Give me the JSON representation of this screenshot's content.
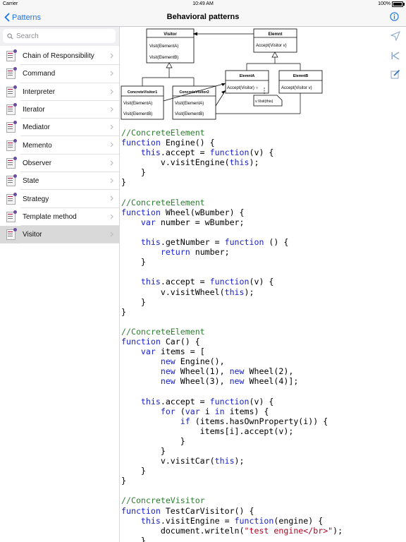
{
  "status_bar": {
    "carrier": "Carrier",
    "time": "10:49 AM",
    "battery": "100%"
  },
  "navbar": {
    "back_label": "Patterns",
    "title": "Behavioral patterns"
  },
  "search": {
    "placeholder": "Search"
  },
  "sidebar": {
    "items": [
      {
        "label": "Chain of Responsibility"
      },
      {
        "label": "Command"
      },
      {
        "label": "Interpreter"
      },
      {
        "label": "Iterator"
      },
      {
        "label": "Mediator"
      },
      {
        "label": "Memento"
      },
      {
        "label": "Observer"
      },
      {
        "label": "State"
      },
      {
        "label": "Strategy"
      },
      {
        "label": "Template method"
      },
      {
        "label": "Visitor",
        "selected": true
      }
    ]
  },
  "diagram": {
    "visitor": {
      "name": "Visitor",
      "ops": [
        "Visit(ElementA)",
        "Visit(ElementB)"
      ]
    },
    "element": {
      "name": "Elemnt",
      "ops": [
        "Accept(Visitor v)"
      ]
    },
    "concrete_visitor1": {
      "name": "ConcreteVisitor1",
      "ops": [
        "Visit(ElementA)",
        "Visit(ElementB)"
      ]
    },
    "concrete_visitor2": {
      "name": "ConcreteVisitor2",
      "ops": [
        "Visit(ElementA)",
        "Visit(ElementB)"
      ]
    },
    "element_a": {
      "name": "ElemntA",
      "ops": [
        "Accept(Visitor) ○"
      ]
    },
    "element_b": {
      "name": "ElemntB",
      "ops": [
        "Accept(Visitor v)"
      ]
    },
    "note": "v.Visit(this)"
  },
  "code_lines": [
    [
      {
        "t": "//ConcreteElement",
        "c": "c"
      }
    ],
    [
      {
        "t": "function",
        "c": "k"
      },
      {
        "t": " Engine() {"
      }
    ],
    [
      {
        "t": "    "
      },
      {
        "t": "this",
        "c": "k"
      },
      {
        "t": ".accept = "
      },
      {
        "t": "function",
        "c": "k"
      },
      {
        "t": "(v) {"
      }
    ],
    [
      {
        "t": "        v.visitEngine("
      },
      {
        "t": "this",
        "c": "k"
      },
      {
        "t": ");"
      }
    ],
    [
      {
        "t": "    }"
      }
    ],
    [
      {
        "t": "}"
      }
    ],
    [
      {
        "t": ""
      }
    ],
    [
      {
        "t": "//ConcreteElement",
        "c": "c"
      }
    ],
    [
      {
        "t": "function",
        "c": "k"
      },
      {
        "t": " Wheel(wBumber) {"
      }
    ],
    [
      {
        "t": "    "
      },
      {
        "t": "var",
        "c": "k"
      },
      {
        "t": " number = wBumber;"
      }
    ],
    [
      {
        "t": ""
      }
    ],
    [
      {
        "t": "    "
      },
      {
        "t": "this",
        "c": "k"
      },
      {
        "t": ".getNumber = "
      },
      {
        "t": "function",
        "c": "k"
      },
      {
        "t": " () {"
      }
    ],
    [
      {
        "t": "        "
      },
      {
        "t": "return",
        "c": "k"
      },
      {
        "t": " number;"
      }
    ],
    [
      {
        "t": "    }"
      }
    ],
    [
      {
        "t": ""
      }
    ],
    [
      {
        "t": "    "
      },
      {
        "t": "this",
        "c": "k"
      },
      {
        "t": ".accept = "
      },
      {
        "t": "function",
        "c": "k"
      },
      {
        "t": "(v) {"
      }
    ],
    [
      {
        "t": "        v.visitWheel("
      },
      {
        "t": "this",
        "c": "k"
      },
      {
        "t": ");"
      }
    ],
    [
      {
        "t": "    }"
      }
    ],
    [
      {
        "t": "}"
      }
    ],
    [
      {
        "t": ""
      }
    ],
    [
      {
        "t": "//ConcreteElement",
        "c": "c"
      }
    ],
    [
      {
        "t": "function",
        "c": "k"
      },
      {
        "t": " Car() {"
      }
    ],
    [
      {
        "t": "    "
      },
      {
        "t": "var",
        "c": "k"
      },
      {
        "t": " items = ["
      }
    ],
    [
      {
        "t": "        "
      },
      {
        "t": "new",
        "c": "k"
      },
      {
        "t": " Engine(),"
      }
    ],
    [
      {
        "t": "        "
      },
      {
        "t": "new",
        "c": "k"
      },
      {
        "t": " Wheel(1), "
      },
      {
        "t": "new",
        "c": "k"
      },
      {
        "t": " Wheel(2),"
      }
    ],
    [
      {
        "t": "        "
      },
      {
        "t": "new",
        "c": "k"
      },
      {
        "t": " Wheel(3), "
      },
      {
        "t": "new",
        "c": "k"
      },
      {
        "t": " Wheel(4)];"
      }
    ],
    [
      {
        "t": ""
      }
    ],
    [
      {
        "t": "    "
      },
      {
        "t": "this",
        "c": "k"
      },
      {
        "t": ".accept = "
      },
      {
        "t": "function",
        "c": "k"
      },
      {
        "t": "(v) {"
      }
    ],
    [
      {
        "t": "        "
      },
      {
        "t": "for",
        "c": "k"
      },
      {
        "t": " ("
      },
      {
        "t": "var",
        "c": "k"
      },
      {
        "t": " i "
      },
      {
        "t": "in",
        "c": "k"
      },
      {
        "t": " items) {"
      }
    ],
    [
      {
        "t": "            "
      },
      {
        "t": "if",
        "c": "k"
      },
      {
        "t": " (items.hasOwnProperty(i)) {"
      }
    ],
    [
      {
        "t": "                items[i].accept(v);"
      }
    ],
    [
      {
        "t": "            }"
      }
    ],
    [
      {
        "t": "        }"
      }
    ],
    [
      {
        "t": "        v.visitCar("
      },
      {
        "t": "this",
        "c": "k"
      },
      {
        "t": ");"
      }
    ],
    [
      {
        "t": "    }"
      }
    ],
    [
      {
        "t": "}"
      }
    ],
    [
      {
        "t": ""
      }
    ],
    [
      {
        "t": "//ConcreteVisitor",
        "c": "c"
      }
    ],
    [
      {
        "t": "function",
        "c": "k"
      },
      {
        "t": " TestCarVisitor() {"
      }
    ],
    [
      {
        "t": "    "
      },
      {
        "t": "this",
        "c": "k"
      },
      {
        "t": ".visitEngine = "
      },
      {
        "t": "function",
        "c": "k"
      },
      {
        "t": "(engine) {"
      }
    ],
    [
      {
        "t": "        document.writeln("
      },
      {
        "t": "\"test engine</br>\"",
        "c": "s"
      },
      {
        "t": ");"
      }
    ],
    [
      {
        "t": "    }"
      }
    ]
  ],
  "icons": {
    "back": "chevron-left-icon",
    "info": "info-icon",
    "search": "magnifier-icon",
    "send": "send-icon",
    "skip": "skip-back-icon",
    "edit": "edit-icon"
  },
  "colors": {
    "accent": "#1a73e8",
    "comment": "#2e7d32",
    "keyword": "#1a22c8",
    "string": "#b00020",
    "selected_row": "#d9d9d9"
  }
}
